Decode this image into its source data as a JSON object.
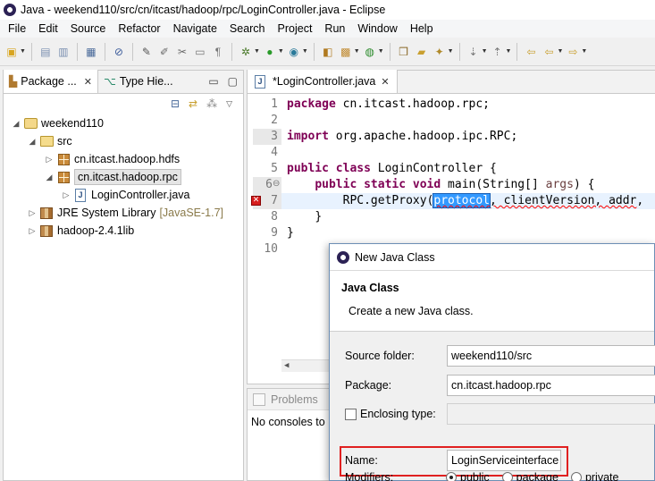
{
  "window": {
    "title": "Java - weekend110/src/cn/itcast/hadoop/rpc/LoginController.java - Eclipse"
  },
  "menu": [
    "File",
    "Edit",
    "Source",
    "Refactor",
    "Navigate",
    "Search",
    "Project",
    "Run",
    "Window",
    "Help"
  ],
  "left_panel": {
    "tabs": [
      {
        "label": "Package ...",
        "active": true
      },
      {
        "label": "Type Hie...",
        "active": false
      }
    ],
    "tree": [
      {
        "label": "weekend110",
        "icon": "project-icon",
        "level": 0,
        "expanded": true
      },
      {
        "label": "src",
        "icon": "source-folder-icon",
        "level": 1,
        "expanded": true
      },
      {
        "label": "cn.itcast.hadoop.hdfs",
        "icon": "package-icon",
        "level": 2,
        "expanded": false
      },
      {
        "label": "cn.itcast.hadoop.rpc",
        "icon": "package-icon",
        "level": 2,
        "expanded": true,
        "selected": true
      },
      {
        "label": "LoginController.java",
        "icon": "java-file-icon",
        "level": 3,
        "expanded": false
      },
      {
        "label": "JRE System Library",
        "tag": "[JavaSE-1.7]",
        "icon": "library-icon",
        "level": 1,
        "expanded": false
      },
      {
        "label": "hadoop-2.4.1lib",
        "icon": "library-icon",
        "level": 1,
        "expanded": false
      }
    ]
  },
  "editor": {
    "tab_label": "*LoginController.java",
    "line_numbers": [
      "1",
      "2",
      "3",
      "4",
      "5",
      "6",
      "7",
      "8",
      "9",
      "10"
    ],
    "code": {
      "l1_kw": "package",
      "l1_rest": " cn.itcast.hadoop.rpc;",
      "l3_kw": "import",
      "l3_rest": " org.apache.hadoop.ipc.RPC;",
      "l5_kw1": "public",
      "l5_kw2": "class",
      "l5_rest": " LoginController {",
      "l6_kw1": "public",
      "l6_kw2": "static",
      "l6_kw3": "void",
      "l6_mid": " main(String[] ",
      "l6_param": "args",
      "l6_end": ") {",
      "l7_pre": "RPC.getProxy(",
      "l7_sel": "protocol",
      "l7_mid": ", clientVersion, ",
      "l7_addr": "addr",
      "l7_end": ",",
      "l8": "}",
      "l9": "}"
    }
  },
  "bottom_panel": {
    "tab_label": "Problems",
    "console_text": "No consoles to"
  },
  "dialog": {
    "title": "New Java Class",
    "header_title": "Java Class",
    "header_msg": "Create a new Java class.",
    "source_folder_label": "Source folder:",
    "source_folder_value": "weekend110/src",
    "package_label": "Package:",
    "package_value": "cn.itcast.hadoop.rpc",
    "enclosing_label": "Enclosing type:",
    "name_label": "Name:",
    "name_value": "LoginServiceinterface",
    "modifiers_label": "Modifiers:",
    "modifier_options": [
      "public",
      "package",
      "private"
    ]
  },
  "colors": {
    "keyword": "#7f0055",
    "selection": "#3399ff",
    "highlight_box": "#e02020",
    "current_line": "#e8f2fe"
  }
}
